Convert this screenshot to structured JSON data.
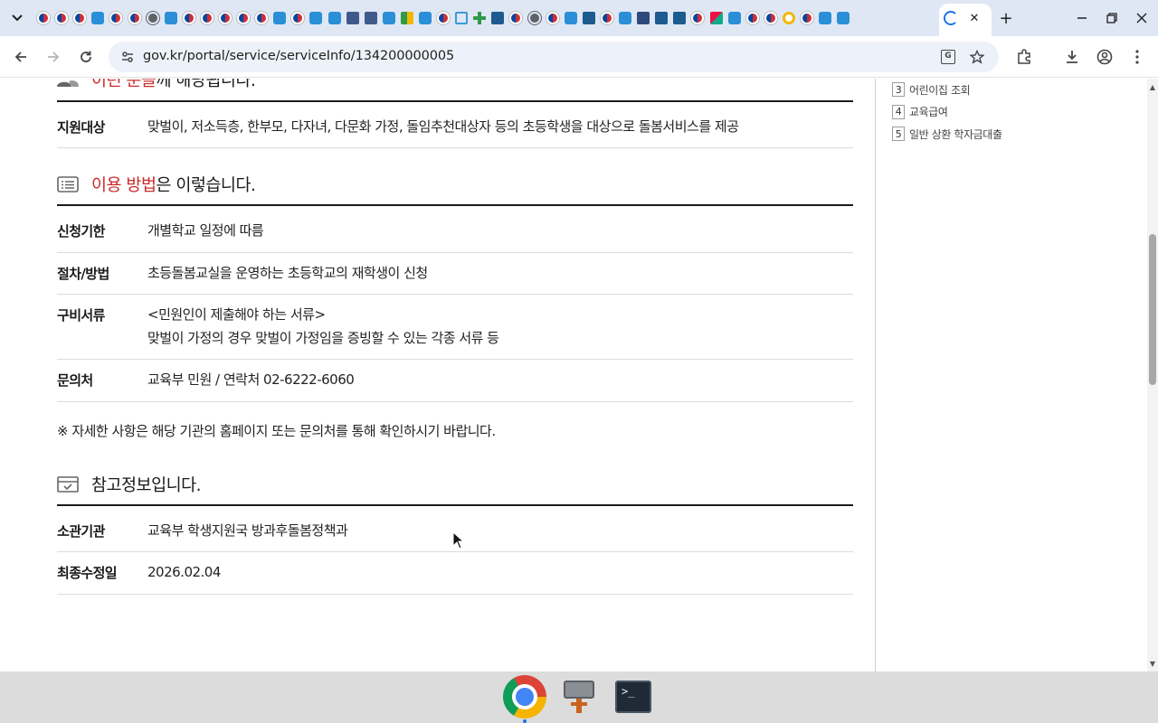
{
  "browser": {
    "url": "gov.kr/portal/service/serviceInfo/134200000005",
    "pinned_tab_icons": [
      "kr",
      "kr",
      "kr",
      "gov",
      "kr",
      "kr",
      "globe",
      "gov",
      "kr",
      "kr",
      "kr",
      "kr",
      "kr",
      "gov",
      "kr",
      "gov",
      "gov",
      "bld",
      "bld",
      "gov",
      "green",
      "gov",
      "kr",
      "home",
      "plus",
      "hometax",
      "kr",
      "globe",
      "kr",
      "gov",
      "hometax",
      "kr",
      "gov",
      "law",
      "hometax",
      "hometax",
      "kr",
      "star",
      "gov",
      "kr",
      "kr",
      "ring",
      "kr",
      "gov",
      "gov"
    ],
    "new_tab_symbol": "+",
    "close_tab_symbol": "✕",
    "minimize_symbol": "—",
    "maximize_symbol": "❐",
    "close_window_symbol": "✕"
  },
  "page": {
    "target_section": {
      "title_highlight": "이런 분들",
      "title_rest": "께 해당됩니다.",
      "rows": [
        {
          "label": "지원대상",
          "value": "맞벌이, 저소득층, 한부모, 다자녀, 다문화 가정, 돌임추천대상자 등의 초등학생을 대상으로 돌봄서비스를 제공"
        }
      ]
    },
    "usage_section": {
      "title_highlight": "이용 방법",
      "title_rest": "은 이렇습니다.",
      "rows": [
        {
          "label": "신청기한",
          "value": "개별학교 일정에 따름"
        },
        {
          "label": "절차/방법",
          "value": "초등돌봄교실을 운영하는 초등학교의 재학생이 신청"
        },
        {
          "label": "구비서류",
          "value_line1": "<민원인이 제출해야 하는 서류>",
          "value_line2": "맞벌이 가정의 경우 맞벌이 가정임을 증빙할 수 있는 각종 서류 등"
        },
        {
          "label": "문의처",
          "value": "교육부 민원 / 연락처 02-6222-6060"
        }
      ]
    },
    "notice": "※ 자세한 사항은 해당 기관의 홈페이지 또는 문의처를 통해 확인하시기 바랍니다.",
    "reference_section": {
      "title": "참고정보입니다.",
      "rows": [
        {
          "label": "소관기관",
          "value": "교육부 학생지원국 방과후돌봄정책과"
        },
        {
          "label": "최종수정일",
          "value": "2026.02.04"
        }
      ]
    },
    "sidebar": {
      "items": [
        {
          "num": "3",
          "label": "어린이집 조회"
        },
        {
          "num": "4",
          "label": "교육급여"
        },
        {
          "num": "5",
          "label": "일반 상환 학자금대출"
        }
      ]
    }
  },
  "dock": {
    "apps": [
      "chrome-icon",
      "tool-icon",
      "terminal-icon"
    ],
    "terminal_prompt": ">_"
  }
}
